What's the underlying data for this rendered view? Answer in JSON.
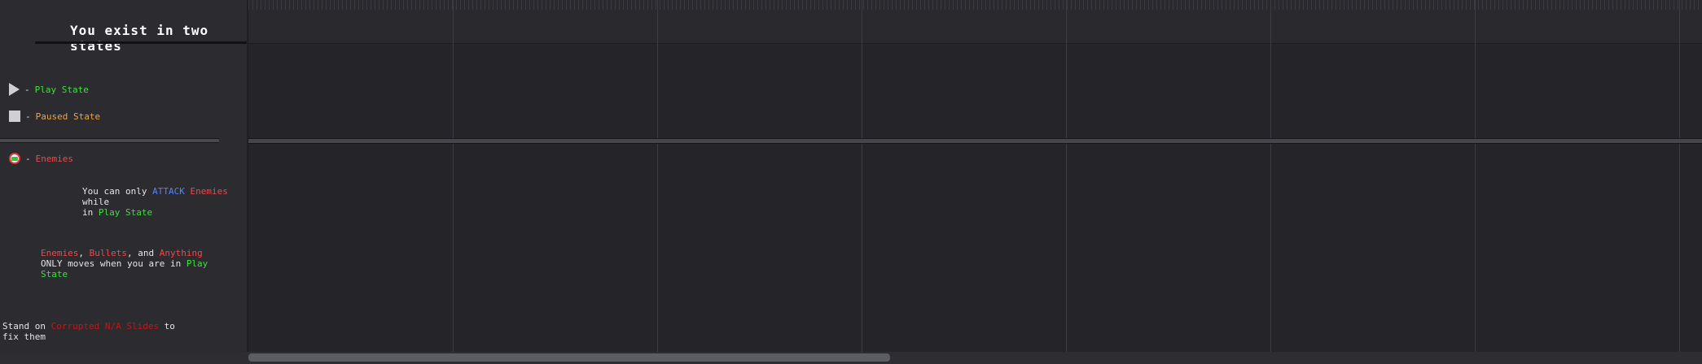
{
  "panel": {
    "title": "You exist in two states",
    "play_state": {
      "icon": "play-icon",
      "dash": "-",
      "label": "Play State"
    },
    "paused_state": {
      "icon": "stop-square-icon",
      "dash": "-",
      "label": "Paused State"
    },
    "enemies": {
      "icon": "enemy-icon",
      "dash": "-",
      "label": "Enemies"
    },
    "tip_attack": {
      "p1": "You can only ",
      "attack": "ATTACK",
      "sp": " ",
      "enemies": "Enemies",
      "p2": " while",
      "p3": "in ",
      "play_state": "Play State"
    },
    "tip_moves": {
      "enemies": "Enemies",
      "comma1": ", ",
      "bullets": "Bullets",
      "p1": ", and ",
      "anything": "Anything",
      "p2": "ONLY moves when you are in ",
      "play": "Play",
      "state": "State"
    },
    "tip_corrupt": {
      "p1": "Stand on ",
      "corrupted": "Corrupted N/A Slides",
      "p2": " to",
      "p3": "fix them"
    }
  },
  "colors": {
    "play": "#3ee03e",
    "paused": "#f3a53a",
    "enemy": "#f04848",
    "attack": "#4f86ff",
    "corrupted": "#c01818"
  }
}
